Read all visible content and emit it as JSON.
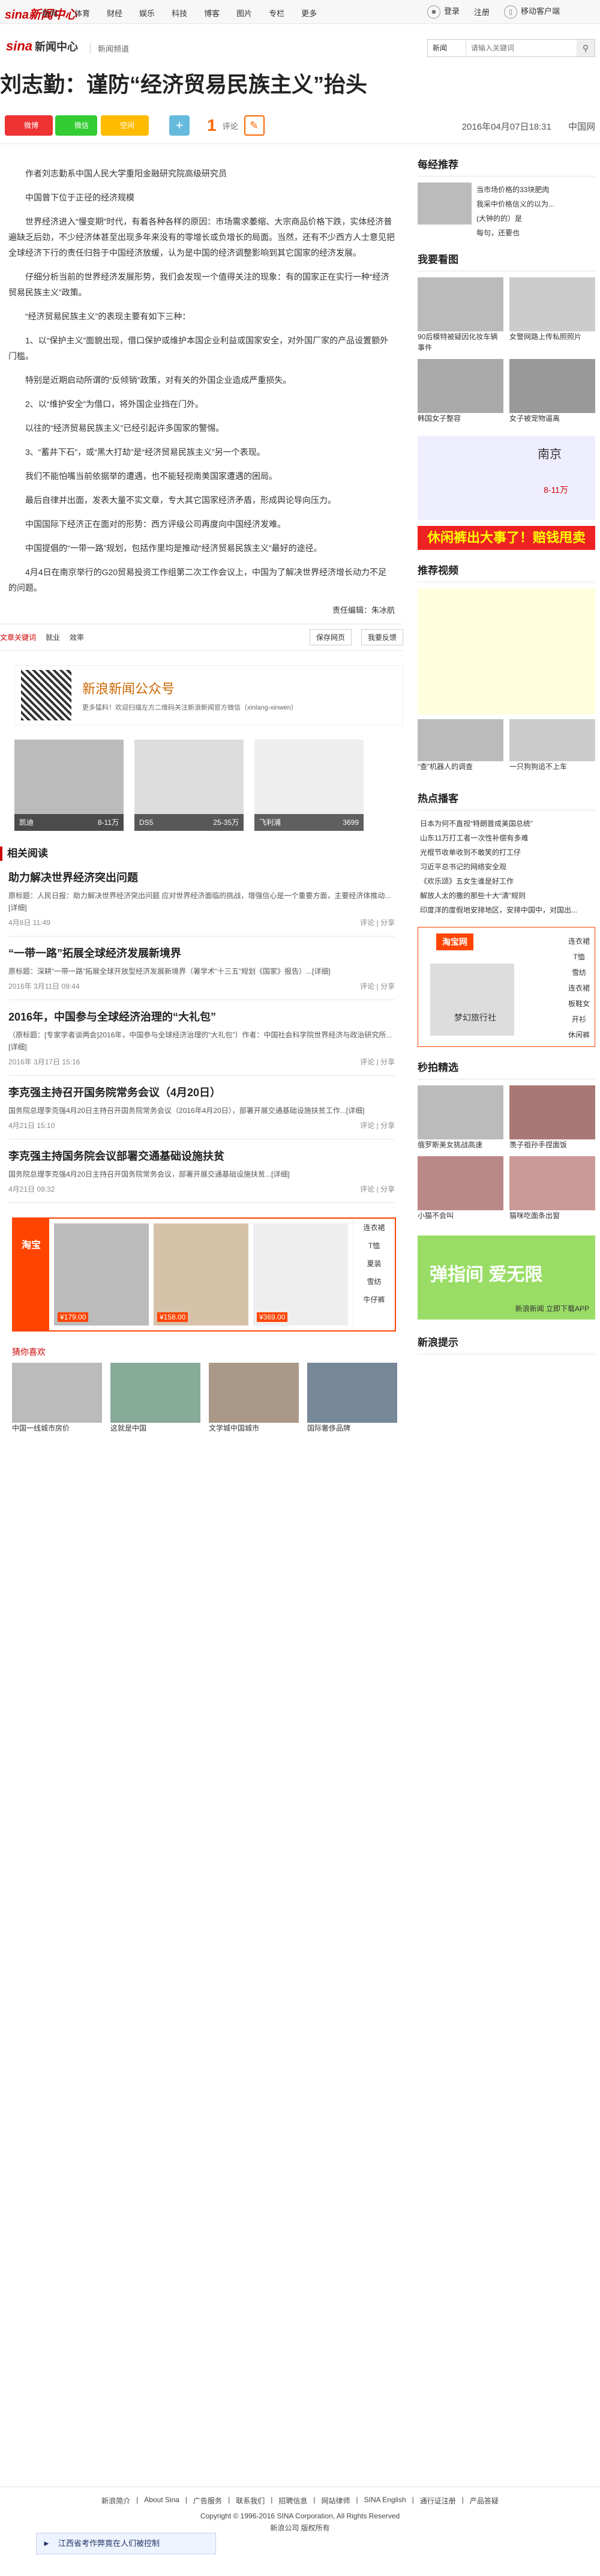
{
  "topbar": {
    "logo": "sina新闻中心",
    "nav": [
      "新闻",
      "体育",
      "财经",
      "娱乐",
      "科技",
      "博客",
      "图片",
      "专栏",
      "更多"
    ],
    "login": "登录",
    "register": "注册",
    "mobile": "移动客户端"
  },
  "header": {
    "logo": "sina",
    "logo_text": "新闻中心",
    "sub": "新闻频道",
    "search_scope": "新闻",
    "search_placeholder": "请输入关键词"
  },
  "article": {
    "title": "刘志勤：谨防“经济贸易民族主义”抬头",
    "share": [
      "微博",
      "微信",
      "空间"
    ],
    "comment_count": "1",
    "comment_label": "评论",
    "datetime": "2016年04月07日18:31",
    "source": "中国网",
    "paragraphs": [
      "作者刘志勤系中国人民大学重阳金融研究院高级研究员",
      "中国曾下位于正径的经济规模",
      "世界经济进入“慢变期”时代，有着各种各样的原因：市场需求萎缩、大宗商品价格下跌，实体经济普遍缺乏后劲，不少经济体甚至出现多年来没有的零增长或负增长的局面。当然，还有不少西方人士意见把全球经济下行的责任归咎于中国经济放缓，认为是中国的经济调整影响到其它国家的经济发展。",
      "仔细分析当前的世界经济发展形势，我们会发现一个值得关注的现象：有的国家正在实行一种“经济贸易民族主义”政策。",
      "“经济贸易民族主义”的表现主要有如下三种：",
      "1、以“保护主义”面貌出现，借口保护或维护本国企业利益或国家安全，对外国厂家的产品设置额外门槛。",
      "特别是近期启动所谓的“反倾销”政策，对有关的外国企业造成严重损失。",
      "2、以“维护安全”为借口，将外国企业挡在门外。",
      "以往的“经济贸易民族主义”已经引起许多国家的警惕。",
      "3、“蓄井下石”，或“黑大打劫”是“经济贸易民族主义”另一个表现。",
      "我们不能怕嘴当前依据举的遭遇，也不能轻视南美国家遭遇的困局。",
      "最后自律并出面，发表大量不实文章，专大其它国家经济矛盾，形成舆论导向压力。",
      "中国国际下经济正在面对的形势：西方评级公司再度向中国经济发难。",
      "中国提倡的“一带一路”规划，包括作里均是推动“经济贸易民族主义”最好的途径。",
      "4月4日在南京举行的G20贸易投资工作组第二次工作会议上，中国为了解决世界经济增长动力不足的问题。"
    ],
    "editor": "责任编辑：朱冰航",
    "article_actions": [
      "文章关键词",
      "就业",
      "效率",
      "我要反馈",
      "保存网页"
    ]
  },
  "wechat_promo": {
    "title": "新浪新闻公众号",
    "sub": "更多猛料！欢迎扫描左方二维码关注新浪新闻官方微信（xinlang-xinwen）"
  },
  "car_ads": [
    {
      "name": "凯迪",
      "price": "8-11万"
    },
    {
      "name": "DS5",
      "price": "25-35万"
    },
    {
      "name": "飞利浦",
      "price": "3699"
    }
  ],
  "related": {
    "label": "相关阅读",
    "items": [
      {
        "title": "助力解决世界经济突出问题",
        "desc": "原标题：人民日报：助力解决世界经济突出问题 应对世界经济面临的挑战，增强信心是一个重要方面，主要经济体推动...[详细]",
        "date": "4月8日 11:49"
      },
      {
        "title": "“一带一路”拓展全球经济发展新境界",
        "desc": "原标题：深耕“一带一路”拓展全球开放型经济发展新境界（署学术“十三五”规划《国家》报告）...[详细]",
        "date": "2016年 3月11日 09:44"
      },
      {
        "title": "2016年，中国参与全球经济治理的“大礼包”",
        "desc": "（原标题：[专家学者谈两会]2016年，中国参与全球经济治理的“大礼包”）作者：中国社会科学院世界经济与政治研究所...[详细]",
        "date": "2016年 3月17日 15:16"
      },
      {
        "title": "李克强主持召开国务院常务会议（4月20日）",
        "desc": "国务院总理李克强4月20日主持召开国务院常务会议（2016年4月20日），部署开展交通基础设施扶贫工作...[详细]",
        "date": "4月21日 15:10"
      },
      {
        "title": "李克强主持国务院会议部署交通基础设施扶贫",
        "desc": "国务院总理李克强4月20日主持召开国务院常务会议，部署开展交通基础设施扶贫...[详细]",
        "date": "4月21日 09:32"
      }
    ],
    "comment": "评论",
    "share": "分享"
  },
  "shop_ad": {
    "prices": [
      "¥179.00",
      "¥158.00",
      "¥369.00"
    ],
    "cats": [
      "连衣裙",
      "T恤",
      "夏装",
      "雪纺",
      "牛仔裤"
    ]
  },
  "recommend": {
    "label": "猜你喜欢",
    "items": [
      "中国一线城市房价",
      "这就是中国",
      "文学城中国城市",
      "国际奢侈品牌"
    ]
  },
  "footer_links": [
    "新浪简介",
    "About Sina",
    "广告服务",
    "联系我们",
    "招聘信息",
    "网站律师",
    "SINA English",
    "通行证注册",
    "产品答疑"
  ],
  "copyright": "Copyright © 1996-2016 SINA Corporation, All Rights Reserved",
  "copyright2": "新浪公司 版权所有",
  "ticker": "江西省考作弊竟在人们被控制",
  "side": {
    "headlines": {
      "title": "每经推荐",
      "items": [
        "当市场价格的33块肥肉",
        "我采中价格信义的以为...",
        "(大钟的的）是",
        "每句，还要也"
      ]
    },
    "watch": {
      "title": "我要看图",
      "items": [
        "90后模特被疑因化妆车辆事件",
        "女警网路上传私照照片",
        "韩国女子整容",
        "女子被宠物逼离"
      ]
    },
    "car_ad": "休闲裤出大事了！赔钱甩卖",
    "car_ad_name": "南京",
    "car_ad_price": "8-11万",
    "video": {
      "title": "推荐视频",
      "items": [
        "“查”机器人的调查",
        "一只狗狗追不上车"
      ]
    },
    "hot": {
      "title": "热点播客",
      "items": [
        "日本为何不直视“特朗普成美国总统”",
        "山东11万打工者一次性补偿有多难",
        "光棍节收单收到不敢笑的打工仔",
        "习近平总书记的网络安全观",
        "《欢乐颂》五女生谁是好工作",
        "解放人太的撒的那些十大“清”规则",
        "印度洋的度假地安排地区，安排中国中，对国出..."
      ]
    },
    "taobao": {
      "label": "淘宝网",
      "cats": [
        "连衣裙",
        "T恤",
        "雪纺",
        "连衣裙",
        "板鞋女",
        "开衫",
        "休闲裤"
      ],
      "promo": "梦幻旅行社"
    },
    "quick": {
      "title": "秒拍精选",
      "items": [
        "俄罗斯美女挑战高速",
        "羡子祖孙手捏面饭",
        "小猫不会叫",
        "猫咪吃面条出窗"
      ]
    },
    "app": {
      "label": "弹指间 爱无限",
      "sub": "新浪新闻 立即下载APP"
    },
    "latest": {
      "title": "新浪提示"
    }
  }
}
